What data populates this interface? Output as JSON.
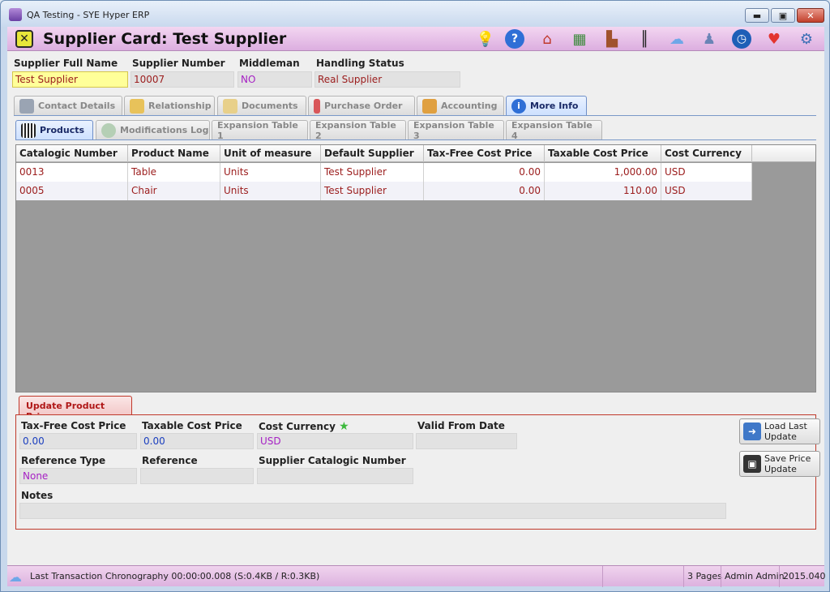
{
  "window": {
    "title": "QA Testing - SYE Hyper ERP",
    "minimize_label": "▬",
    "maximize_label": "▣",
    "close_label": "✕"
  },
  "header": {
    "close_label": "✕",
    "title": "Supplier Card:  Test Supplier",
    "icons": [
      "lightbulb-icon",
      "help-icon",
      "home-icon",
      "money-icon",
      "factory-icon",
      "barcode-icon",
      "cloud-icon",
      "users-icon",
      "clock-icon",
      "heart-icon",
      "settings-icon"
    ]
  },
  "fields": {
    "full_name_label": "Supplier Full Name",
    "full_name_value": "Test Supplier",
    "number_label": "Supplier Number",
    "number_value": "10007",
    "middleman_label": "Middleman",
    "middleman_value": "NO",
    "handling_label": "Handling Status",
    "handling_value": "Real Supplier"
  },
  "main_tabs": [
    {
      "label": "Contact Details"
    },
    {
      "label": "Relationship"
    },
    {
      "label": "Documents"
    },
    {
      "label": "Purchase Order"
    },
    {
      "label": "Accounting"
    },
    {
      "label": "More Info"
    }
  ],
  "sub_tabs": [
    {
      "label": "Products"
    },
    {
      "label": "Modifications Log"
    },
    {
      "label": "Expansion Table 1"
    },
    {
      "label": "Expansion Table 2"
    },
    {
      "label": "Expansion Table 3"
    },
    {
      "label": "Expansion Table 4"
    }
  ],
  "table": {
    "columns": [
      "Catalogic Number",
      "Product Name",
      "Unit of measure",
      "Default Supplier",
      "Tax-Free  Cost Price",
      "Taxable  Cost Price",
      "Cost Currency"
    ],
    "rows": [
      [
        "0013",
        "Table",
        "Units",
        "Test Supplier",
        "0.00",
        "1,000.00",
        "USD"
      ],
      [
        "0005",
        "Chair",
        "Units",
        "Test Supplier",
        "0.00",
        "110.00",
        "USD"
      ]
    ]
  },
  "update_panel": {
    "tab_label": "Update Product Price",
    "tax_free_label": "Tax-Free  Cost Price",
    "tax_free_value": "0.00",
    "taxable_label": "Taxable  Cost Price",
    "taxable_value": "0.00",
    "currency_label": "Cost Currency",
    "currency_value": "USD",
    "valid_from_label": "Valid From Date",
    "valid_from_value": "",
    "ref_type_label": "Reference Type",
    "ref_type_value": "None",
    "reference_label": "Reference",
    "reference_value": "",
    "supplier_cat_label": "Supplier Catalogic Number",
    "supplier_cat_value": "",
    "notes_label": "Notes",
    "notes_value": "",
    "load_last_line1": "Load Last",
    "load_last_line2": "Update",
    "save_price_line1": "Save Price",
    "save_price_line2": "Update"
  },
  "status": {
    "message": "Last Transaction Chronography  00:00:00.008   (S:0.4KB / R:0.3KB)",
    "pages": "3 Pages",
    "user": "Admin Admin",
    "version": "2015.040"
  }
}
